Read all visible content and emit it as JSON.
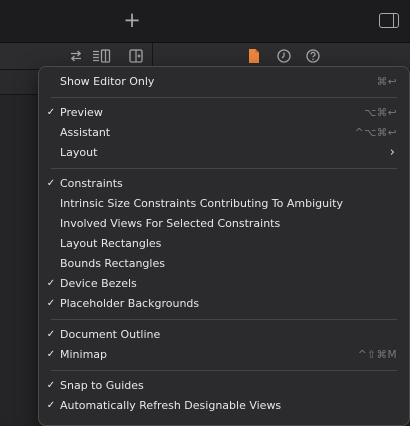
{
  "tabbar": {
    "add_glyph": "+",
    "add_icon": "plus-icon",
    "inspector_icon": "inspector-toggle-icon"
  },
  "toolbar": {
    "icons": [
      "related-items-icon",
      "editor-options-icon",
      "add-editor-icon",
      "file-inspector-icon",
      "history-icon",
      "help-icon"
    ],
    "accent": "#f0883e"
  },
  "menu": {
    "groups": [
      [
        {
          "label": "Show Editor Only",
          "checked": false,
          "shortcut": "⌘↩"
        }
      ],
      [
        {
          "label": "Preview",
          "checked": true,
          "shortcut": "⌥⌘↩"
        },
        {
          "label": "Assistant",
          "checked": false,
          "shortcut": "^⌥⌘↩"
        },
        {
          "label": "Layout",
          "checked": false,
          "submenu": "›"
        }
      ],
      [
        {
          "label": "Constraints",
          "checked": true
        },
        {
          "label": "Intrinsic Size Constraints Contributing To Ambiguity",
          "checked": false
        },
        {
          "label": "Involved Views For Selected Constraints",
          "checked": false
        },
        {
          "label": "Layout Rectangles",
          "checked": false
        },
        {
          "label": "Bounds Rectangles",
          "checked": false
        },
        {
          "label": "Device Bezels",
          "checked": true
        },
        {
          "label": "Placeholder Backgrounds",
          "checked": true
        }
      ],
      [
        {
          "label": "Document Outline",
          "checked": true
        },
        {
          "label": "Minimap",
          "checked": true,
          "shortcut": "^⇧⌘M"
        }
      ],
      [
        {
          "label": "Snap to Guides",
          "checked": true
        },
        {
          "label": "Automatically Refresh Designable Views",
          "checked": true
        }
      ]
    ]
  }
}
